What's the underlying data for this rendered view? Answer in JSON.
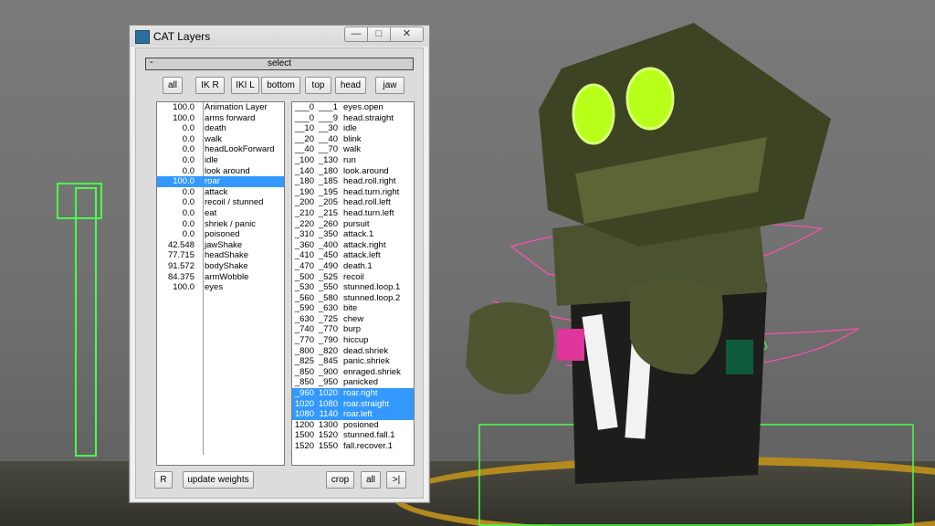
{
  "window": {
    "title": "CAT Layers",
    "minimize": "—",
    "maximize": "□",
    "close": "✕",
    "icon": "app-icon"
  },
  "rollout": {
    "collapse": "-",
    "title": "select"
  },
  "filters": [
    "all",
    "IK R",
    "IKI L",
    "bottom",
    "top",
    "head",
    "jaw"
  ],
  "layers": [
    {
      "weight": "100.0",
      "name": "Animation Layer",
      "selected": false
    },
    {
      "weight": "100.0",
      "name": "arms forward",
      "selected": false
    },
    {
      "weight": "0.0",
      "name": "death",
      "selected": false
    },
    {
      "weight": "0.0",
      "name": "walk",
      "selected": false
    },
    {
      "weight": "0.0",
      "name": "headLookForward",
      "selected": false
    },
    {
      "weight": "0.0",
      "name": "idle",
      "selected": false
    },
    {
      "weight": "0.0",
      "name": "look around",
      "selected": false
    },
    {
      "weight": "100.0",
      "name": "roar",
      "selected": true
    },
    {
      "weight": "0.0",
      "name": "attack",
      "selected": false
    },
    {
      "weight": "0.0",
      "name": "recoil / stunned",
      "selected": false
    },
    {
      "weight": "0.0",
      "name": "eat",
      "selected": false
    },
    {
      "weight": "0.0",
      "name": "shriek / panic",
      "selected": false
    },
    {
      "weight": "0.0",
      "name": "poisoned",
      "selected": false
    },
    {
      "weight": "42.548",
      "name": "jawShake",
      "selected": false
    },
    {
      "weight": "77.715",
      "name": "headShake",
      "selected": false
    },
    {
      "weight": "91.572",
      "name": "bodyShake",
      "selected": false
    },
    {
      "weight": "84.375",
      "name": "armWobble",
      "selected": false
    },
    {
      "weight": "100.0",
      "name": "eyes",
      "selected": false
    }
  ],
  "ranges": [
    {
      "start": "___0",
      "end": "___1",
      "name": "eyes.open",
      "selected": false
    },
    {
      "start": "___0",
      "end": "___9",
      "name": "head.straight",
      "selected": false
    },
    {
      "start": "__10",
      "end": "__30",
      "name": "idle",
      "selected": false
    },
    {
      "start": "__20",
      "end": "__40",
      "name": "blink",
      "selected": false
    },
    {
      "start": "__40",
      "end": "__70",
      "name": "walk",
      "selected": false
    },
    {
      "start": "_100",
      "end": "_130",
      "name": "run",
      "selected": false
    },
    {
      "start": "_140",
      "end": "_180",
      "name": "look.around",
      "selected": false
    },
    {
      "start": "_180",
      "end": "_185",
      "name": "head.roll.right",
      "selected": false
    },
    {
      "start": "_190",
      "end": "_195",
      "name": "head.turn.right",
      "selected": false
    },
    {
      "start": "_200",
      "end": "_205",
      "name": "head.roll.left",
      "selected": false
    },
    {
      "start": "_210",
      "end": "_215",
      "name": "head.turn.left",
      "selected": false
    },
    {
      "start": "_220",
      "end": "_260",
      "name": "pursuit",
      "selected": false
    },
    {
      "start": "_310",
      "end": "_350",
      "name": "attack.1",
      "selected": false
    },
    {
      "start": "_360",
      "end": "_400",
      "name": "attack.right",
      "selected": false
    },
    {
      "start": "_410",
      "end": "_450",
      "name": "attack.left",
      "selected": false
    },
    {
      "start": "_470",
      "end": "_490",
      "name": "death.1",
      "selected": false
    },
    {
      "start": "_500",
      "end": "_525",
      "name": "recoil",
      "selected": false
    },
    {
      "start": "_530",
      "end": "_550",
      "name": "stunned.loop.1",
      "selected": false
    },
    {
      "start": "_560",
      "end": "_580",
      "name": "stunned.loop.2",
      "selected": false
    },
    {
      "start": "_590",
      "end": "_630",
      "name": "bite",
      "selected": false
    },
    {
      "start": "_630",
      "end": "_725",
      "name": "chew",
      "selected": false
    },
    {
      "start": "_740",
      "end": "_770",
      "name": "burp",
      "selected": false
    },
    {
      "start": "_770",
      "end": "_790",
      "name": "hiccup",
      "selected": false
    },
    {
      "start": "_800",
      "end": "_820",
      "name": "dead.shriek",
      "selected": false
    },
    {
      "start": "_825",
      "end": "_845",
      "name": "panic.shriek",
      "selected": false
    },
    {
      "start": "_850",
      "end": "_900",
      "name": "enraged.shriek",
      "selected": false
    },
    {
      "start": "_850",
      "end": "_950",
      "name": "panicked",
      "selected": false
    },
    {
      "start": "_960",
      "end": "1020",
      "name": "roar.right",
      "selected": true
    },
    {
      "start": "1020",
      "end": "1080",
      "name": "roar.straight",
      "selected": true
    },
    {
      "start": "1080",
      "end": "1140",
      "name": "roar.left",
      "selected": true
    },
    {
      "start": "1200",
      "end": "1300",
      "name": "posioned",
      "selected": false
    },
    {
      "start": "1500",
      "end": "1520",
      "name": "stunned.fall.1",
      "selected": false
    },
    {
      "start": "1520",
      "end": "1550",
      "name": "fall.recover.1",
      "selected": false
    }
  ],
  "bottom": {
    "r": "R",
    "update": "update weights",
    "crop": "crop",
    "all": "all",
    "next": ">|"
  },
  "colors": {
    "selection": "#3399ff",
    "rig_green": "#4cff4c",
    "rig_pink": "#ff4fb2",
    "floor_ring": "#b48a1e"
  }
}
